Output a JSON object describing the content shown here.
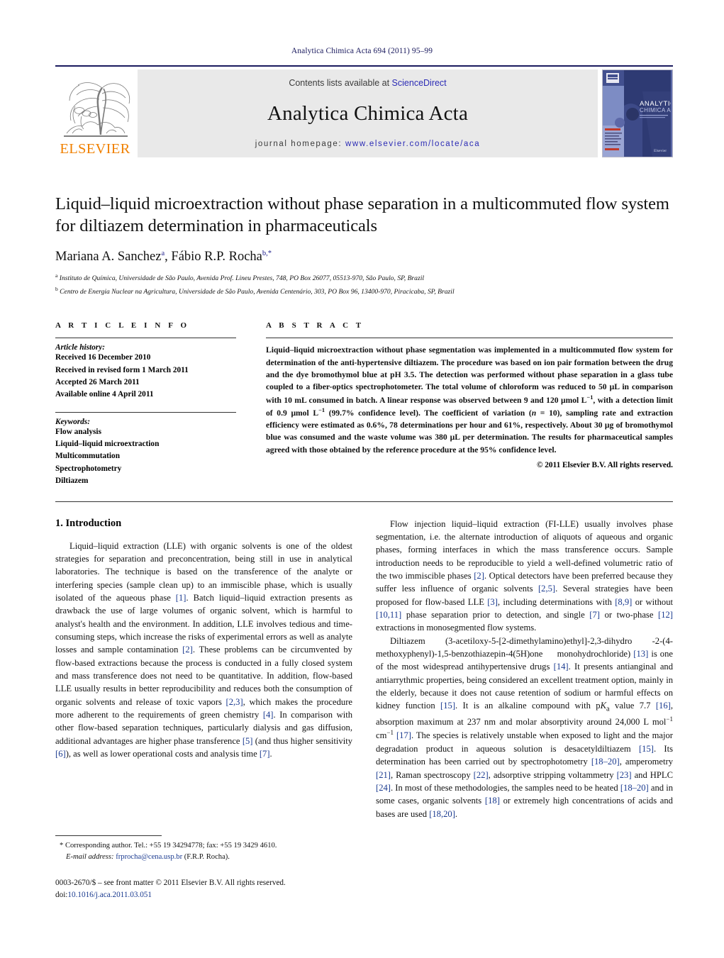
{
  "running_head": "Analytica Chimica Acta 694 (2011) 95–99",
  "masthead": {
    "contents_prefix": "Contents lists available at ",
    "sciencedirect": "ScienceDirect",
    "journal_title": "Analytica Chimica Acta",
    "homepage_prefix": "journal homepage: ",
    "homepage_url": "www.elsevier.com/locate/aca",
    "publisher_wordmark": "ELSEVIER",
    "cover_title_line1": "ANALYTICA",
    "cover_title_line2": "CHIMICA ACTA",
    "link_color": "#2b2bb5",
    "brand_orange": "#F08000",
    "rule_color": "#1a1a5e"
  },
  "article": {
    "title": "Liquid–liquid microextraction without phase separation in a multicommuted flow system for diltiazem determination in pharmaceuticals",
    "authors_html": "Mariana A. Sanchez<sup>a</sup>, Fábio R.P. Rocha<sup>b,</sup><sup>*</sup>",
    "affiliation_a": "Instituto de Química, Universidade de São Paulo, Avenida Prof. Lineu Prestes, 748, PO Box 26077, 05513-970, São Paulo, SP, Brazil",
    "affiliation_b": "Centro de Energia Nuclear na Agricultura, Universidade de São Paulo, Avenida Centenário, 303, PO Box 96, 13400-970, Piracicaba, SP, Brazil"
  },
  "info": {
    "heading": "A R T I C L E    I N F O",
    "history_label": "Article history:",
    "history": [
      "Received 16 December 2010",
      "Received in revised form 1 March 2011",
      "Accepted 26 March 2011",
      "Available online 4 April 2011"
    ],
    "keywords_label": "Keywords:",
    "keywords": [
      "Flow analysis",
      "Liquid–liquid microextraction",
      "Multicommutation",
      "Spectrophotometry",
      "Diltiazem"
    ]
  },
  "abstract": {
    "heading": "A B S T R A C T",
    "text_html": "Liquid–liquid microextraction without phase segmentation was implemented in a multicommuted flow system for determination of the anti-hypertensive diltiazem. The procedure was based on ion pair formation between the drug and the dye bromothymol blue at pH 3.5. The detection was performed without phase separation in a glass tube coupled to a fiber-optics spectrophotometer. The total volume of chloroform was reduced to 50 &#956;L in comparison with 10 mL consumed in batch. A linear response was observed between 9 and 120 &#956;mol L<sup>&#8722;1</sup>, with a detection limit of 0.9 &#956;mol L<sup>&#8722;1</sup> (99.7% confidence level). The coefficient of variation (<i>n</i> = 10), sampling rate and extraction efficiency were estimated as 0.6%, 78 determinations per hour and 61%, respectively. About 30 &#956;g of bromothymol blue was consumed and the waste volume was 380 &#956;L per determination. The results for pharmaceutical samples agreed with those obtained by the reference procedure at the 95% confidence level.",
    "copyright": "© 2011 Elsevier B.V. All rights reserved."
  },
  "body": {
    "section_number_title": "1.  Introduction",
    "left_paragraphs_html": [
      "Liquid–liquid extraction (LLE) with organic solvents is one of the oldest strategies for separation and preconcentration, being still in use in analytical laboratories. The technique is based on the transference of the analyte or interfering species (sample clean up) to an immiscible phase, which is usually isolated of the aqueous phase <span class=\"ref\">[1]</span>. Batch liquid–liquid extraction presents as drawback the use of large volumes of organic solvent, which is harmful to analyst's health and the environment. In addition, LLE involves tedious and time-consuming steps, which increase the risks of experimental errors as well as analyte losses and sample contamination <span class=\"ref\">[2]</span>. These problems can be circumvented by flow-based extractions because the process is conducted in a fully closed system and mass transference does not need to be quantitative. In addition, flow-based LLE usually results in better reproducibility and reduces both the consumption of organic solvents and release of toxic vapors <span class=\"ref\">[2,3]</span>, which makes the procedure more adherent to the requirements of green chemistry <span class=\"ref\">[4]</span>. In comparison with other flow-based separation techniques, particularly dialysis and gas diffusion, additional advantages are higher phase transference <span class=\"ref\">[5]</span> (and thus higher sensitivity <span class=\"ref\">[6]</span>), as well as lower operational costs and analysis time <span class=\"ref\">[7]</span>."
    ],
    "right_paragraphs_html": [
      "Flow injection liquid–liquid extraction (FI-LLE) usually involves phase segmentation, i.e. the alternate introduction of aliquots of aqueous and organic phases, forming interfaces in which the mass transference occurs. Sample introduction needs to be reproducible to yield a well-defined volumetric ratio of the two immiscible phases <span class=\"ref\">[2]</span>. Optical detectors have been preferred because they suffer less influence of organic solvents <span class=\"ref\">[2,5]</span>. Several strategies have been proposed for flow-based LLE <span class=\"ref\">[3]</span>, including determinations with <span class=\"ref\">[8,9]</span> or without <span class=\"ref\">[10,11]</span> phase separation prior to detection, and single <span class=\"ref\">[7]</span> or two-phase <span class=\"ref\">[12]</span> extractions in monosegmented flow systems.",
      "Diltiazem (3-acetiloxy-5-[2-dimethylamino)ethyl]-2,3-dihydro -2-(4-methoxyphenyl)-1,5-benzothiazepin-4(5H)one&nbsp;&nbsp;&nbsp;&nbsp; monohydrochloride) <span class=\"ref\">[13]</span> is one of the most widespread antihypertensive drugs <span class=\"ref\">[14]</span>. It presents antianginal and antiarrythmic properties, being considered an excellent treatment option, mainly in the elderly, because it does not cause retention of sodium or harmful effects on kidney function <span class=\"ref\">[15]</span>. It is an alkaline compound with p<i>K</i><sub>a</sub> value 7.7 <span class=\"ref\">[16]</span>, absorption maximum at 237 nm and molar absorptivity around 24,000 L mol<sup>&#8722;1</sup> cm<sup>&#8722;1</sup> <span class=\"ref\">[17]</span>. The species is relatively unstable when exposed to light and the major degradation product in aqueous solution is desacetyldiltiazem <span class=\"ref\">[15]</span>. Its determination has been carried out by spectrophotometry <span class=\"ref\">[18–20]</span>, amperometry <span class=\"ref\">[21]</span>, Raman spectroscopy <span class=\"ref\">[22]</span>, adsorptive stripping voltammetry <span class=\"ref\">[23]</span> and HPLC <span class=\"ref\">[24]</span>. In most of these methodologies, the samples need to be heated <span class=\"ref\">[18–20]</span> and in some cases, organic solvents <span class=\"ref\">[18]</span> or extremely high concentrations of acids and bases are used <span class=\"ref\">[18,20]</span>."
    ]
  },
  "footnotes": {
    "corresponding_html": "<span class=\"star\">*</span> Corresponding author. Tel.: +55 19 34294778; fax: +55 19 3429 4610.",
    "email_html": "<i>E-mail address:</i> <span class=\"fn-link\">frprocha@cena.usp.br</span> (F.R.P. Rocha).",
    "issn_line": "0003-2670/$ – see front matter © 2011 Elsevier B.V. All rights reserved.",
    "doi_prefix": "doi:",
    "doi_value": "10.1016/j.aca.2011.03.051"
  }
}
